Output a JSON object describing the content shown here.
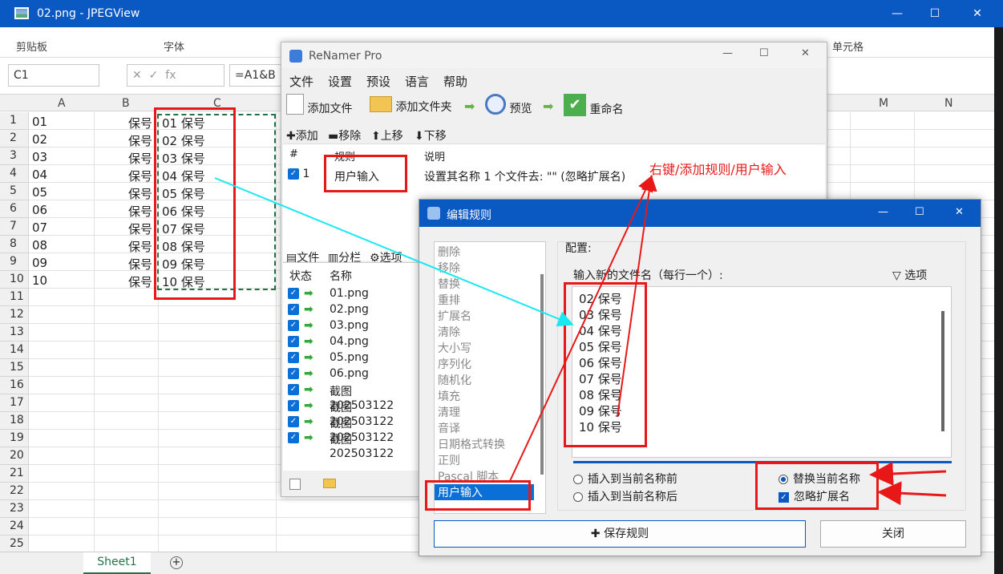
{
  "jpegview": {
    "title": "02.png - JPEGView",
    "min": "—",
    "max": "☐",
    "close": "✕"
  },
  "excel": {
    "ribbon": {
      "clipboard": "剪贴板",
      "font": "字体",
      "cells": "单元格"
    },
    "namebox": "C1",
    "fx": "fx",
    "formula": "=A1&B",
    "columns": [
      "A",
      "B",
      "C",
      "M",
      "N"
    ],
    "rows": [
      "1",
      "2",
      "3",
      "4",
      "5",
      "6",
      "7",
      "8",
      "9",
      "10",
      "11",
      "12",
      "13",
      "14",
      "15",
      "16",
      "17",
      "18",
      "19",
      "20",
      "21",
      "22",
      "23",
      "24",
      "25"
    ],
    "col_a": [
      "01",
      "02",
      "03",
      "04",
      "05",
      "06",
      "07",
      "08",
      "09",
      "10"
    ],
    "col_b": [
      "保号",
      "保号",
      "保号",
      "保号",
      "保号",
      "保号",
      "保号",
      "保号",
      "保号",
      "保号"
    ],
    "col_c": [
      "01 保号",
      "02 保号",
      "03 保号",
      "04 保号",
      "05 保号",
      "06 保号",
      "07 保号",
      "08 保号",
      "09 保号",
      "10 保号"
    ],
    "sheet_tab": "Sheet1"
  },
  "renamer": {
    "title": "ReNamer Pro",
    "menu": [
      "文件",
      "设置",
      "预设",
      "语言",
      "帮助"
    ],
    "toolbar": {
      "add_files": "添加文件",
      "add_folder": "添加文件夹",
      "preview": "预览",
      "rename": "重命名"
    },
    "rule_actions": {
      "add": "添加",
      "remove": "移除",
      "up": "上移",
      "down": "下移"
    },
    "rules_table": {
      "col_num": "#",
      "col_rule": "规则",
      "col_desc": "说明",
      "row_num": "1",
      "row_rule": "用户输入",
      "row_desc": "设置其名称 1 个文件去: \"\" (忽略扩展名)"
    },
    "file_tabs": {
      "files": "文件",
      "columns": "分栏",
      "options": "选项"
    },
    "file_table": {
      "col_status": "状态",
      "col_name": "名称"
    },
    "files": [
      "01.png",
      "02.png",
      "03.png",
      "04.png",
      "05.png",
      "06.png",
      "截图202503122",
      "截图202503122",
      "截图202503122",
      "截图202503122"
    ]
  },
  "annotation": "右键/添加规则/用户输入",
  "edit_rule": {
    "title": "编辑规则",
    "rules": [
      "删除",
      "移除",
      "替换",
      "重排",
      "扩展名",
      "清除",
      "大小写",
      "序列化",
      "随机化",
      "填充",
      "清理",
      "音译",
      "日期格式转换",
      "正则",
      "Pascal 脚本",
      "用户输入"
    ],
    "config_label": "配置:",
    "input_label": "输入新的文件名（每行一个）:",
    "options_label": "选项",
    "lines": [
      "02 保号",
      "03 保号",
      "04 保号",
      "05 保号",
      "06 保号",
      "07 保号",
      "08 保号",
      "09 保号",
      "10 保号"
    ],
    "insert_before": "插入到当前名称前",
    "insert_after": "插入到当前名称后",
    "replace_current": "替换当前名称",
    "ignore_ext": "忽略扩展名",
    "save_rule": "保存规则",
    "close": "关闭"
  }
}
